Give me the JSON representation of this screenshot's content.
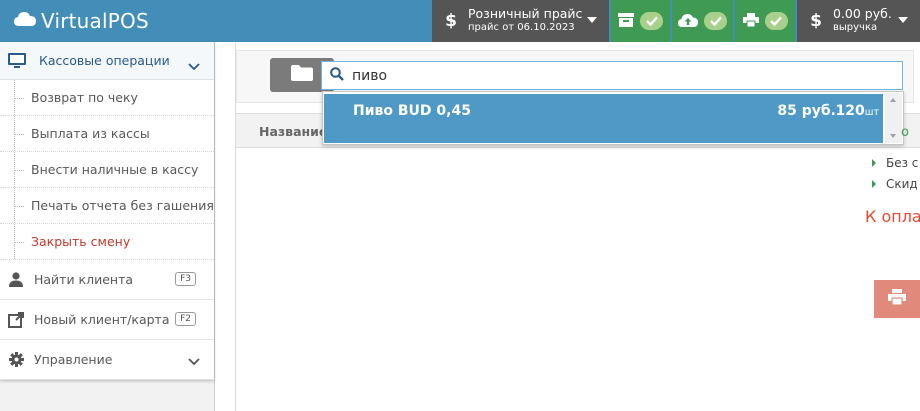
{
  "app": {
    "title": "VirtualPOS"
  },
  "topbar": {
    "price_list": {
      "label": "Розничный прайс",
      "sublabel": "прайс от 06.10.2023"
    },
    "revenue": {
      "amount": "0.00 руб.",
      "label": "выручка"
    },
    "currency_symbol": "$",
    "status_color": "#a8d08d",
    "icons": [
      "archive-icon",
      "cloud-upload-icon",
      "print-icon"
    ]
  },
  "sidebar": {
    "section": {
      "label": "Кассовые операции",
      "icon": "desktop-icon"
    },
    "items": [
      {
        "label": "Возврат по чеку"
      },
      {
        "label": "Выплата из кассы"
      },
      {
        "label": "Внести наличные в кассу"
      },
      {
        "label": "Печать отчета без гашения"
      },
      {
        "label": "Закрыть смену",
        "active": true
      }
    ],
    "find_client": {
      "label": "Найти клиента",
      "shortcut": "F3"
    },
    "new_client": {
      "label": "Новый клиент/карта",
      "shortcut": "F2"
    },
    "management": {
      "label": "Управление"
    }
  },
  "search": {
    "value": "пиво",
    "placeholder": ""
  },
  "table": {
    "headers": [
      "Название"
    ]
  },
  "dropdown": {
    "items": [
      {
        "name": "Пиво BUD 0,45",
        "price": "85 руб.",
        "qty": "120",
        "unit": "шт"
      }
    ]
  },
  "right_panel": {
    "q": "о",
    "options": [
      "Без с",
      "Скид"
    ],
    "to_pay": "К оплат"
  },
  "colors": {
    "header": "#438eb9",
    "accent_green": "#3f9a53",
    "highlight": "#4f99c6",
    "danger": "#e34b31"
  }
}
